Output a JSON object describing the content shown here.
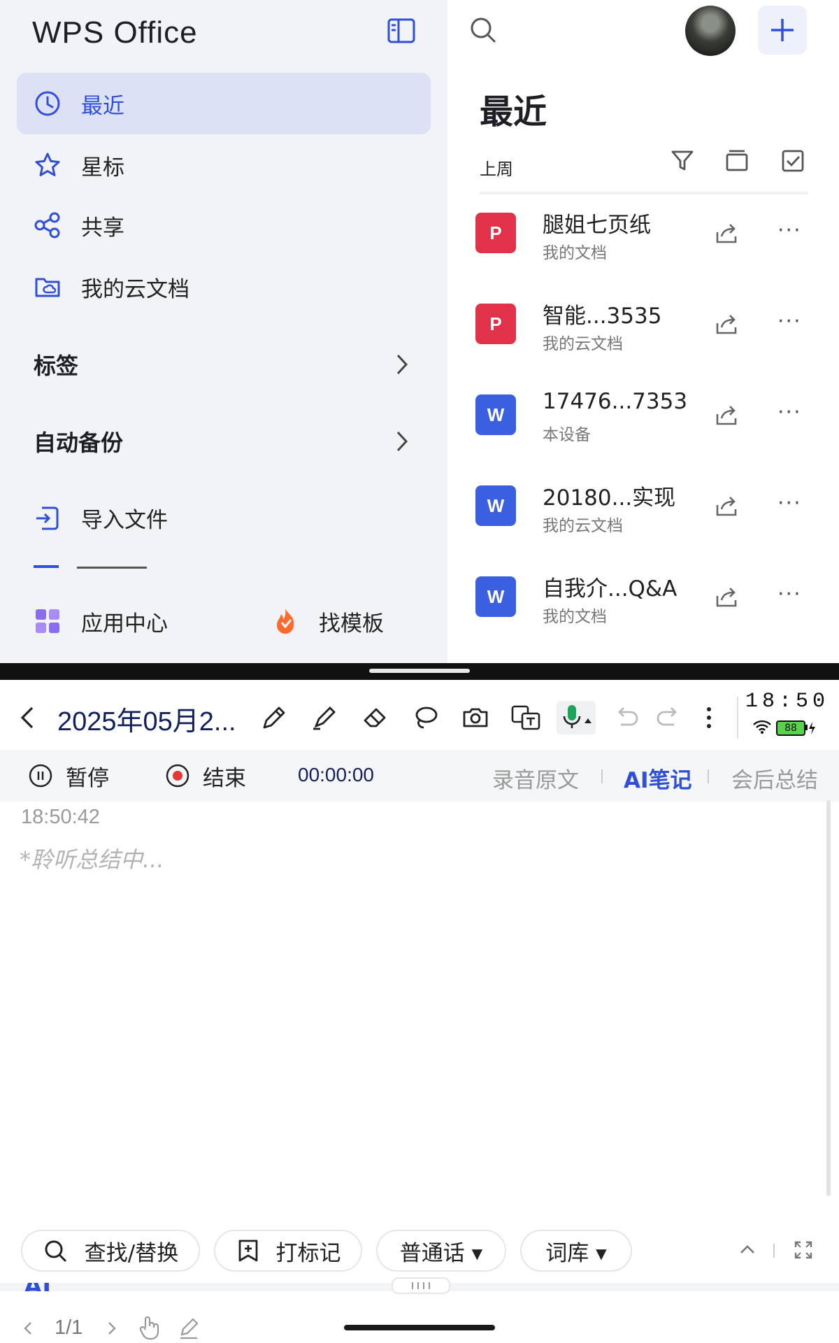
{
  "sidebar": {
    "logo": "WPS Office",
    "nav": [
      {
        "label": "最近",
        "icon": "clock-icon"
      },
      {
        "label": "星标",
        "icon": "star-icon"
      },
      {
        "label": "共享",
        "icon": "share-nodes-icon"
      },
      {
        "label": "我的云文档",
        "icon": "cloud-folder-icon"
      }
    ],
    "tags_label": "标签",
    "backup_label": "自动备份",
    "import_label": "导入文件",
    "app_center_label": "应用中心",
    "template_label": "找模板"
  },
  "main": {
    "title": "最近",
    "period": "上周",
    "files": [
      {
        "name": "腿姐七页纸",
        "location": "我的文档",
        "type": "pdf",
        "badge": "P"
      },
      {
        "name": "智能...3535",
        "location": "我的云文档",
        "type": "pdf",
        "badge": "P"
      },
      {
        "name": "17476...7353",
        "location": "本设备",
        "type": "word",
        "badge": "W"
      },
      {
        "name": "20180...实现",
        "location": "我的云文档",
        "type": "word",
        "badge": "W"
      },
      {
        "name": "自我介...Q&A",
        "location": "我的文档",
        "type": "word",
        "badge": "W"
      }
    ]
  },
  "note": {
    "title": "2025年05月2...",
    "clock": "18:50",
    "battery": "88",
    "pause_label": "暂停",
    "end_label": "结束",
    "timer": "00:00:00",
    "tabs": [
      "录音原文",
      "AI笔记",
      "会后总结"
    ],
    "active_tab": 1,
    "timestamp": "18:50:42",
    "placeholder": "*聆听总结中...",
    "bottom": {
      "find_label": "查找/替换",
      "mark_label": "打标记",
      "language_label": "普通话 ▾",
      "lexicon_label": "词库 ▾"
    },
    "page_indicator": "1/1",
    "ai_label": "AI"
  },
  "colors": {
    "accent": "#2f4fd9",
    "pdf": "#e2324a",
    "word": "#3a5fe0",
    "record": "#e53935"
  }
}
